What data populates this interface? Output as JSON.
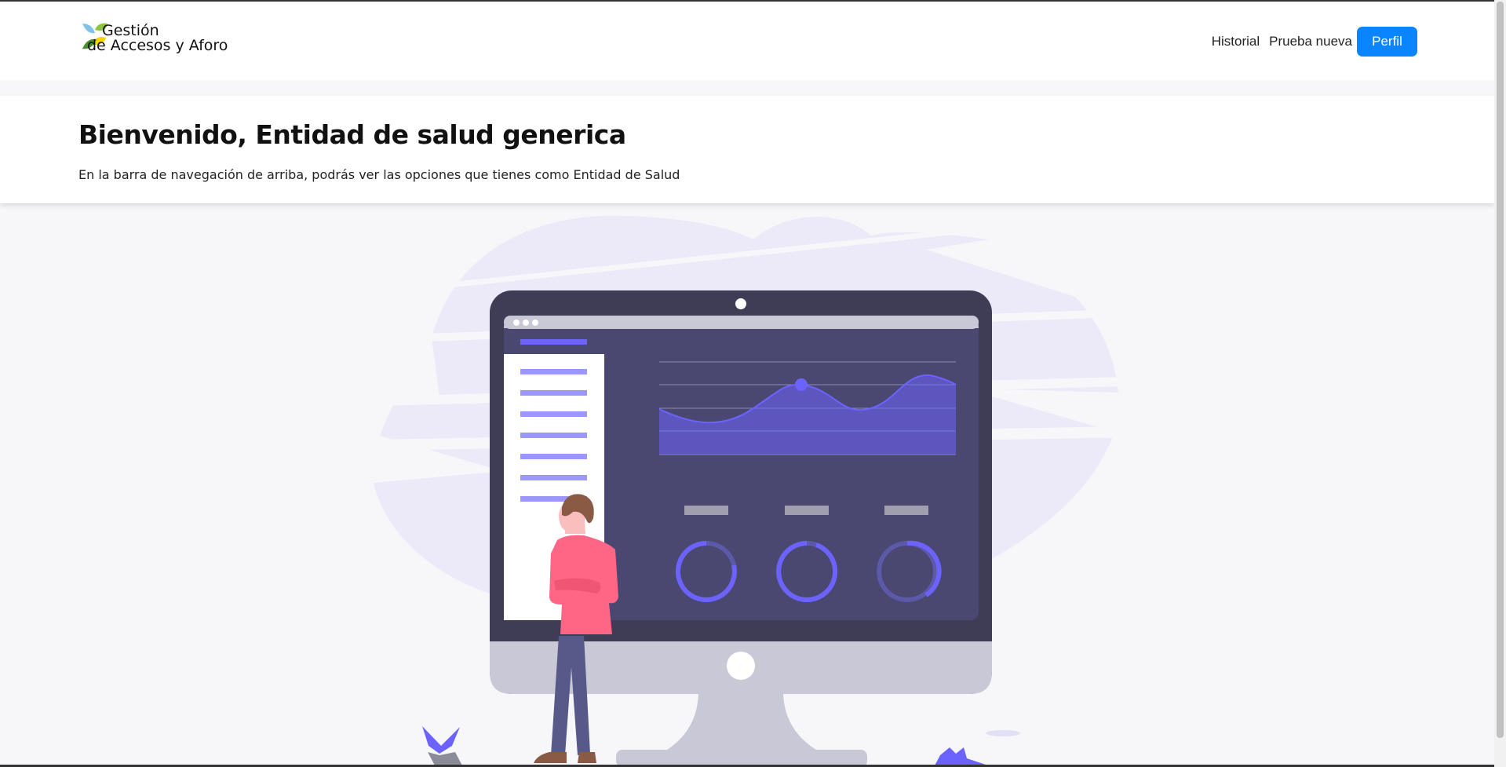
{
  "brand": {
    "line1": "Gestión",
    "line2": "de Accesos y Aforo"
  },
  "nav": {
    "items": [
      "Historial",
      "Prueba nueva"
    ],
    "profile_label": "Perfil"
  },
  "hero": {
    "title": "Bienvenido, Entidad de salud generica",
    "subtitle": "En la barra de navegación de arriba, podrás ver las opciones que tienes como Entidad de Salud"
  },
  "colors": {
    "accent": "#0a84ff",
    "illustration_primary": "#6c63ff",
    "monitor_frame": "#3f3d56",
    "person_shirt": "#ff6584"
  },
  "illustration": {
    "chart_line": [
      0.55,
      0.35,
      0.7,
      0.3,
      0.15
    ],
    "ring_progress": [
      0.85,
      0.95,
      0.55
    ]
  }
}
